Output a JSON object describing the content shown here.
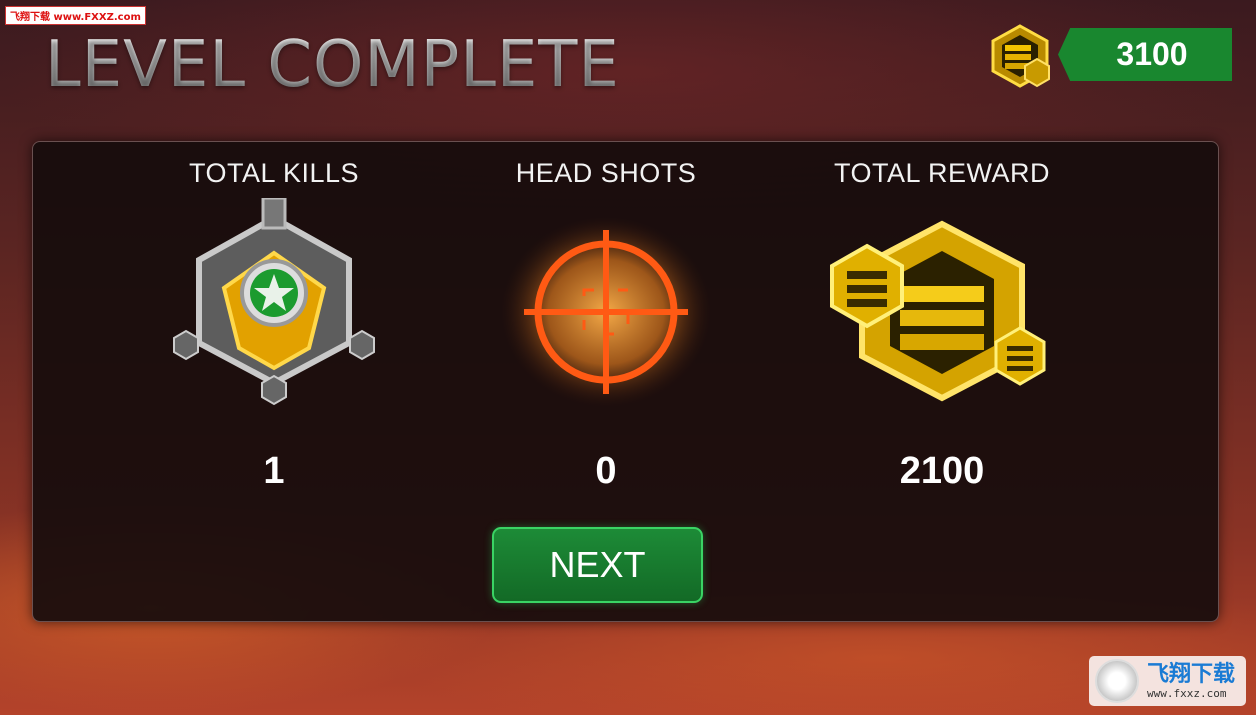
{
  "watermark": {
    "top_text": "飞翔下载 www.FXXZ.com",
    "logo_cn": "飞翔下载",
    "logo_url": "www.fxxz.com"
  },
  "header": {
    "title": "LEVEL COMPLETE",
    "currency": {
      "icon": "gold-stack-icon",
      "value": "3100"
    }
  },
  "stats": [
    {
      "label": "TOTAL KILLS",
      "value": "1",
      "icon": "star-medal-icon"
    },
    {
      "label": "HEAD SHOTS",
      "value": "0",
      "icon": "crosshair-icon"
    },
    {
      "label": "TOTAL REWARD",
      "value": "2100",
      "icon": "gold-stack-icon"
    }
  ],
  "next_button": {
    "label": "NEXT"
  },
  "colors": {
    "accent_green": "#19872f",
    "gold": "#e0b400",
    "panel": "#160c0c"
  }
}
